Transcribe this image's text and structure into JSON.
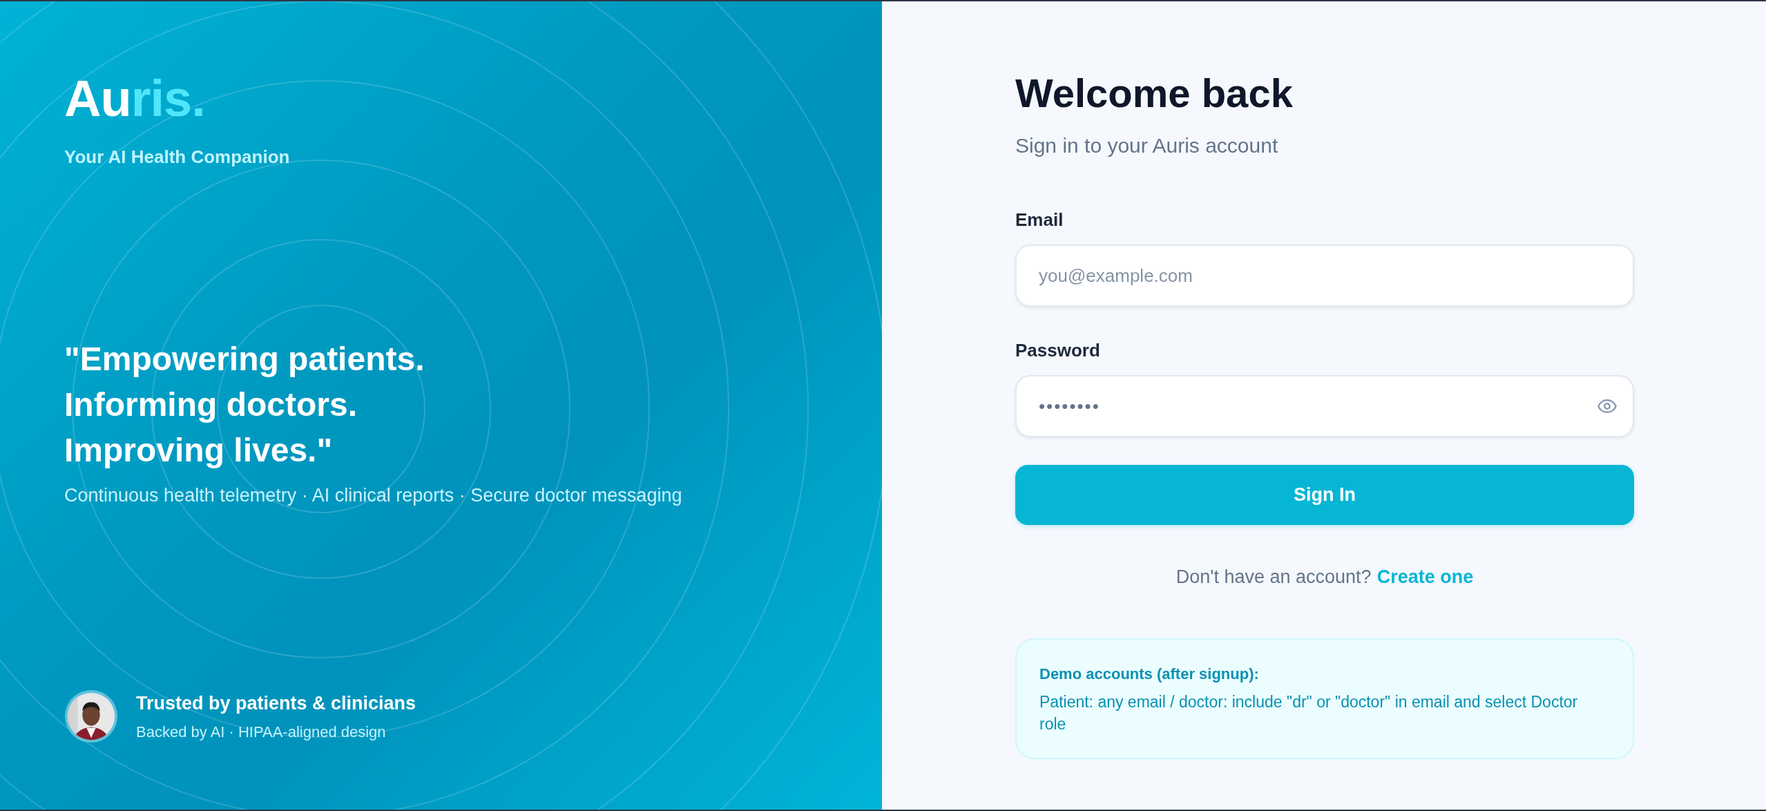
{
  "brand": {
    "logo": [
      {
        "text": "Au",
        "accent": false
      },
      {
        "text": "ris.",
        "accent": true
      }
    ],
    "tagline": "Your AI Health Companion"
  },
  "hero": {
    "quote": [
      "\"Empowering patients.",
      "Informing doctors.",
      "Improving lives.\""
    ],
    "features": "Continuous health telemetry · AI clinical reports · Secure doctor messaging"
  },
  "trust": {
    "title": "Trusted by patients & clinicians",
    "subtitle": "Backed by AI · HIPAA-aligned design"
  },
  "form": {
    "title": "Welcome back",
    "subtitle": "Sign in to your Auris account",
    "fields": [
      {
        "label": "Email",
        "placeholder": "you@example.com",
        "kind": "text"
      },
      {
        "label": "Password",
        "value": "••••••••",
        "kind": "password"
      }
    ],
    "submit": "Sign In",
    "signup_prompt": "Don't have an account?",
    "signup_link": "Create one"
  },
  "demo": {
    "title": "Demo accounts (after signup):",
    "text": "Patient: any email / doctor: include \"dr\" or \"doctor\" in email and select Doctor role"
  }
}
